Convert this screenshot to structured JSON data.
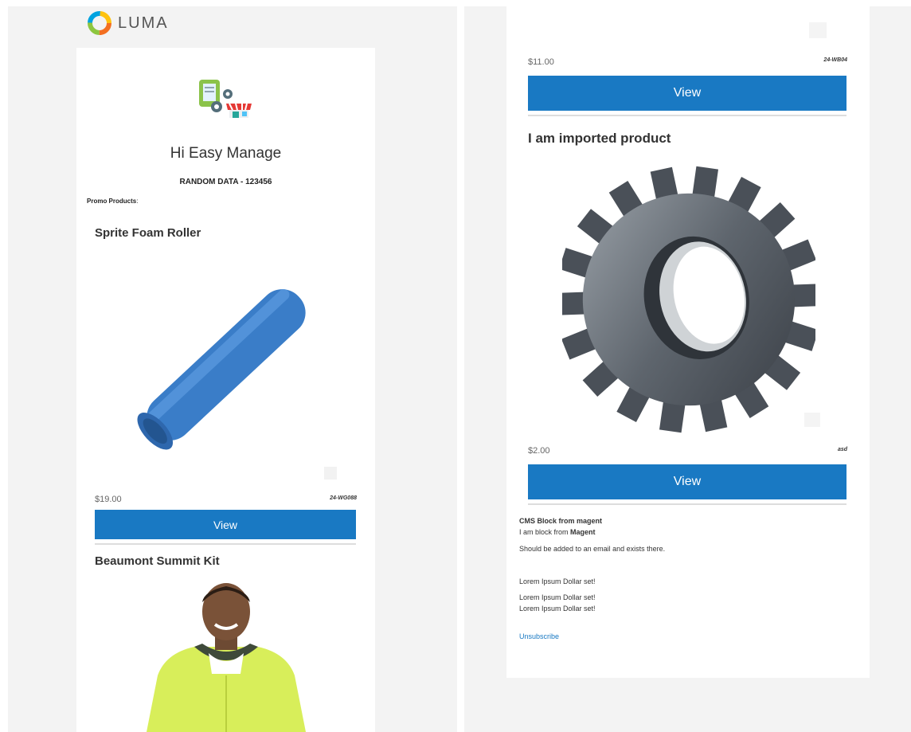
{
  "brand": {
    "logo_text": "LUMA"
  },
  "email": {
    "greeting": "Hi Easy Manage",
    "random_data": "RANDOM DATA - 123456",
    "promo_label": "Promo Products",
    "promo_suffix": ":"
  },
  "products": [
    {
      "name": "Sprite Foam Roller",
      "price": "$19.00",
      "sku": "24-WG088",
      "button": "View"
    },
    {
      "name": "Beaumont Summit Kit"
    },
    {
      "price": "$11.00",
      "sku": "24-WB04",
      "button": "View"
    },
    {
      "name": "I am imported product",
      "price": "$2.00",
      "sku": "asd",
      "button": "View"
    }
  ],
  "cms_block": {
    "title": "CMS Block from magent",
    "line_prefix": "I am block from ",
    "line_bold": "Magent",
    "line2": "Should be added to an email and exists there."
  },
  "lorem": [
    "Lorem Ipsum Dollar set!",
    "Lorem Ipsum Dollar set!",
    "Lorem Ipsum Dollar set!"
  ],
  "unsubscribe": "Unsubscribe",
  "colors": {
    "button_blue": "#1979c3",
    "panel_bg": "#f3f3f3",
    "roller_blue": "#3a7dc8",
    "jacket_yellow": "#d8ee5a"
  }
}
